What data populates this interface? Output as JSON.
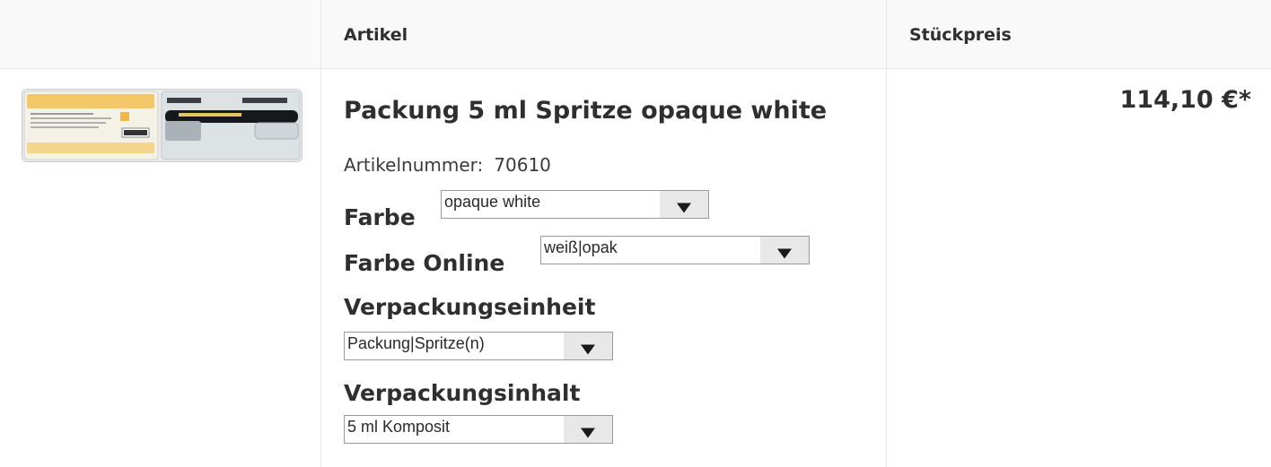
{
  "table": {
    "headers": {
      "image": "",
      "article": "Artikel",
      "unit_price": "Stückpreis"
    }
  },
  "product": {
    "image_alt": "Packung 5 ml Spritze opaque white",
    "title": "Packung 5 ml Spritze opaque white",
    "article_number_label": "Artikelnummer:",
    "article_number": "70610",
    "price": "114,10 €*",
    "options": {
      "farbe": {
        "label": "Farbe",
        "selected": "opaque white"
      },
      "farbe_online": {
        "label": "Farbe Online",
        "selected": "weiß|opak"
      },
      "verpackungseinheit": {
        "label": "Verpackungseinheit",
        "selected": "Packung|Spritze(n)"
      },
      "verpackungsinhalt": {
        "label": "Verpackungsinhalt",
        "selected": "5 ml Komposit"
      }
    }
  },
  "colors": {
    "header_bg": "#f9f9f9",
    "border": "#e6e6e6",
    "text": "#2f2f2f",
    "select_button": "#e8e8e8"
  }
}
